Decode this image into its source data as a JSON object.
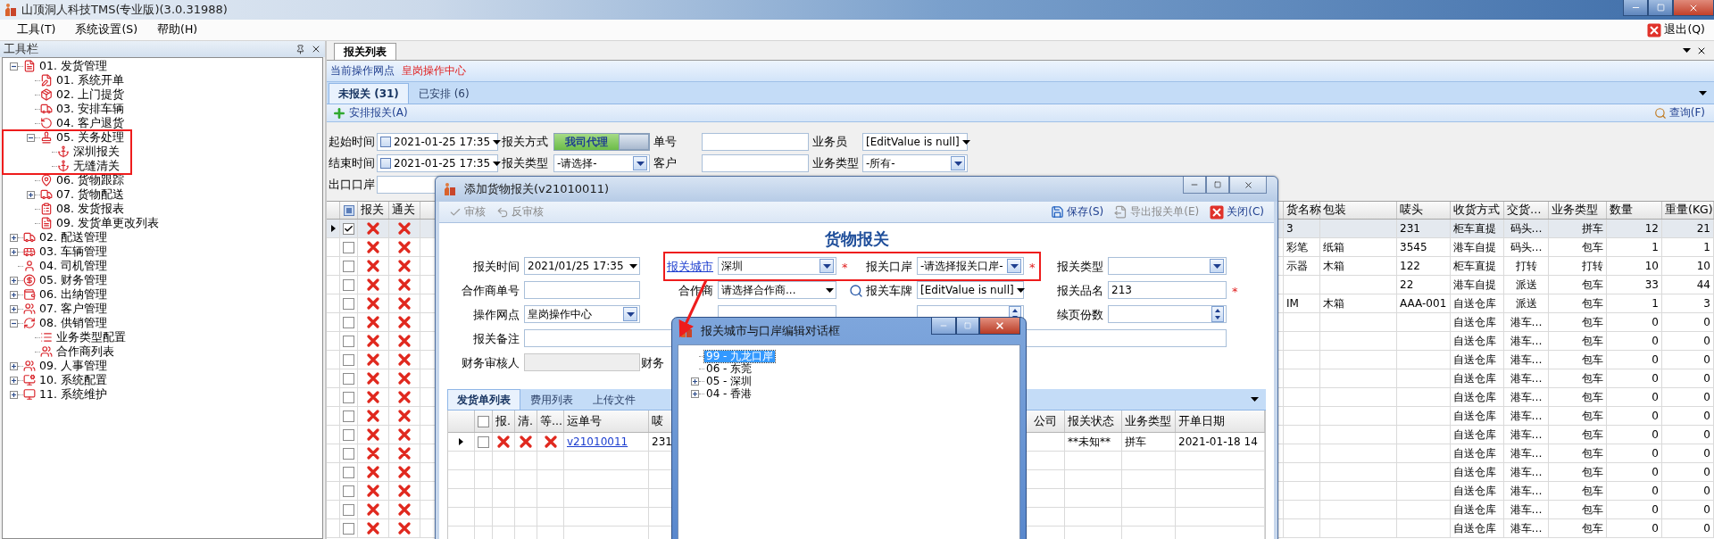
{
  "window": {
    "title": "山顶洞人科技TMS(专业版)(3.0.31988)"
  },
  "menu": [
    "工具(T)",
    "系统设置(S)",
    "帮助(H)"
  ],
  "exit_button": "退出(Q)",
  "sidebar": {
    "title": "工具栏",
    "items": [
      {
        "label": "01. 发货管理",
        "expanded": true,
        "children": [
          {
            "label": "01. 系统开单"
          },
          {
            "label": "02. 上门提货"
          },
          {
            "label": "03. 安排车辆"
          },
          {
            "label": "04. 客户退货"
          },
          {
            "label": "05. 关务处理",
            "expanded": true,
            "children": [
              {
                "label": "深圳报关"
              },
              {
                "label": "无缝清关"
              }
            ]
          },
          {
            "label": "06. 货物跟踪"
          },
          {
            "label": "07. 货物配送",
            "expanded": false
          },
          {
            "label": "08. 发货报表"
          },
          {
            "label": "09. 发货单更改列表"
          }
        ]
      },
      {
        "label": "02. 配送管理",
        "expanded": false
      },
      {
        "label": "03. 车辆管理",
        "expanded": false
      },
      {
        "label": "04. 司机管理"
      },
      {
        "label": "05. 财务管理",
        "expanded": false
      },
      {
        "label": "06. 出纳管理",
        "expanded": false
      },
      {
        "label": "07. 客户管理",
        "expanded": false
      },
      {
        "label": "08. 供销管理",
        "expanded": true,
        "children": [
          {
            "label": "业务类型配置"
          },
          {
            "label": "合作商列表"
          }
        ]
      },
      {
        "label": "09. 人事管理",
        "expanded": false
      },
      {
        "label": "10. 系统配置",
        "expanded": false
      },
      {
        "label": "11. 系统维护",
        "expanded": false
      }
    ]
  },
  "doc_tabs": [
    {
      "label": "报关列表",
      "selected": true
    }
  ],
  "operation_point": {
    "label": "当前操作网点",
    "value": "皇岗操作中心"
  },
  "status_tabs": [
    {
      "label": "未报关 (31)",
      "selected": true
    },
    {
      "label": "已安排 (6)",
      "selected": false
    }
  ],
  "actions": {
    "arrange": "安排报关(A)",
    "query": "查询(F)"
  },
  "filters": [
    [
      {
        "label": "起始时间",
        "kind": "date",
        "value": "2021-01-25 17:35",
        "checked": false
      },
      {
        "label": "报关方式",
        "kind": "switch",
        "value": "我司代理",
        "on": true
      },
      {
        "label": "单号",
        "kind": "text"
      },
      {
        "label": "业务员",
        "kind": "dropdown",
        "value": "[EditValue is null]"
      }
    ],
    [
      {
        "label": "结束时间",
        "kind": "date",
        "value": "2021-01-25 17:35",
        "checked": false
      },
      {
        "label": "报关类型",
        "kind": "select",
        "value": "-请选择-"
      },
      {
        "label": "客户",
        "kind": "text"
      },
      {
        "label": "业务类型",
        "kind": "select",
        "value": "-所有-"
      }
    ],
    [
      {
        "label": "出口口岸",
        "kind": "text"
      }
    ]
  ],
  "table": {
    "status_columns": [
      "报关",
      "通关"
    ],
    "columns": [
      "货名称",
      "包装",
      "唛头",
      "收货方式",
      "交货…",
      "业务类型",
      "数量",
      "重量(KG)"
    ],
    "rows": [
      {
        "selected": true,
        "checked": true,
        "cells": [
          "3",
          "",
          "231",
          "柜车直提",
          "码头…",
          "拼车",
          "12",
          "21"
        ]
      },
      {
        "selected": false,
        "checked": false,
        "cells": [
          "彩笔",
          "纸箱",
          "3545",
          "港车自提",
          "码头…",
          "包车",
          "1",
          "1"
        ]
      },
      {
        "selected": false,
        "checked": false,
        "cells": [
          "示器",
          "木箱",
          "122",
          "柜车直提",
          "打转",
          "打转",
          "10",
          "10"
        ]
      },
      {
        "selected": false,
        "checked": false,
        "cells": [
          "",
          "",
          "22",
          "港车自提",
          "派送",
          "包车",
          "33",
          "44"
        ]
      },
      {
        "selected": false,
        "checked": false,
        "cells": [
          "IM",
          "木箱",
          "AAA-001",
          "自送仓库",
          "派送",
          "包车",
          "1",
          "3"
        ]
      },
      {
        "selected": false,
        "checked": false,
        "cells": [
          "",
          "",
          "",
          "自送仓库",
          "港车…",
          "包车",
          "0",
          "0"
        ]
      },
      {
        "selected": false,
        "checked": false,
        "cells": [
          "",
          "",
          "",
          "自送仓库",
          "港车…",
          "包车",
          "0",
          "0"
        ]
      },
      {
        "selected": false,
        "checked": false,
        "cells": [
          "",
          "",
          "",
          "自送仓库",
          "港车…",
          "包车",
          "0",
          "0"
        ]
      },
      {
        "selected": false,
        "checked": false,
        "cells": [
          "",
          "",
          "",
          "自送仓库",
          "港车…",
          "包车",
          "0",
          "0"
        ]
      },
      {
        "selected": false,
        "checked": false,
        "cells": [
          "",
          "",
          "",
          "自送仓库",
          "港车…",
          "包车",
          "0",
          "0"
        ]
      },
      {
        "selected": false,
        "checked": false,
        "cells": [
          "",
          "",
          "",
          "自送仓库",
          "港车…",
          "包车",
          "0",
          "0"
        ]
      },
      {
        "selected": false,
        "checked": false,
        "cells": [
          "",
          "",
          "",
          "自送仓库",
          "港车…",
          "包车",
          "0",
          "0"
        ]
      },
      {
        "selected": false,
        "checked": false,
        "cells": [
          "",
          "",
          "",
          "自送仓库",
          "港车…",
          "包车",
          "0",
          "0"
        ]
      },
      {
        "selected": false,
        "checked": false,
        "cells": [
          "",
          "",
          "",
          "自送仓库",
          "港车…",
          "包车",
          "0",
          "0"
        ]
      },
      {
        "selected": false,
        "checked": false,
        "cells": [
          "",
          "",
          "",
          "自送仓库",
          "港车…",
          "包车",
          "0",
          "0"
        ]
      },
      {
        "selected": false,
        "checked": false,
        "cells": [
          "",
          "",
          "",
          "自送仓库",
          "港车…",
          "包车",
          "0",
          "0"
        ]
      },
      {
        "selected": false,
        "checked": false,
        "cells": [
          "",
          "",
          "",
          "自送仓库",
          "港车…",
          "包车",
          "0",
          "0"
        ]
      }
    ]
  },
  "cargo_dialog": {
    "title": "添加货物报关(v21010011)",
    "toolbar": [
      {
        "label": "审核",
        "disabled": true
      },
      {
        "label": "反审核",
        "disabled": true
      },
      {
        "label": "保存(S)",
        "disabled": false
      },
      {
        "label": "导出报关单(E)",
        "disabled": true
      },
      {
        "label": "关闭(C)",
        "disabled": false
      }
    ],
    "heading": "货物报关",
    "fields": [
      {
        "label": "报关时间",
        "kind": "date",
        "value": "2021/01/25 17:35"
      },
      {
        "label": "报关城市",
        "kind": "select",
        "value": "深圳",
        "link": true,
        "required_mark": "*"
      },
      {
        "label": "报关口岸",
        "kind": "select",
        "value": "-请选择报关口岸-",
        "required_mark": "*"
      },
      {
        "label": "报关类型",
        "kind": "select"
      },
      {
        "label": "合作商单号",
        "kind": "text"
      },
      {
        "label": "合作商",
        "kind": "dropdown",
        "value": "请选择合作商..."
      },
      {
        "label": "报关车牌",
        "kind": "search_dropdown",
        "value": "[EditValue is null]"
      },
      {
        "label": "报关品名",
        "kind": "text",
        "value": "213",
        "required_mark": "*"
      },
      {
        "label": "操作网点",
        "kind": "select",
        "value": "皇岗操作中心"
      },
      {
        "kind": "text"
      },
      {
        "kind": "spin"
      },
      {
        "label": "续页份数",
        "kind": "spin"
      },
      {
        "label": "报关备注",
        "kind": "wide_text"
      },
      {
        "label": "财务审核人",
        "kind": "readonly"
      },
      {
        "label": "财务",
        "kind": "label"
      }
    ],
    "tabs": [
      {
        "label": "发货单列表",
        "selected": true
      },
      {
        "label": "费用列表",
        "selected": false
      },
      {
        "label": "上传文件",
        "selected": false
      }
    ],
    "grid": {
      "all_checked": false,
      "columns": [
        "报.",
        "清.",
        "等...",
        "运单号",
        "唛",
        "公司",
        "报关状态",
        "业务类型",
        "开单日期"
      ],
      "rows": [
        {
          "selected": true,
          "checked": false,
          "waybill": "v21010011",
          "mark": "231",
          "status": "**未知**",
          "type": "拼车",
          "date": "2021-01-18 14"
        }
      ]
    }
  },
  "port_dialog": {
    "title": "报关城市与口岸编辑对话框",
    "tree": [
      {
        "label": "99 - 九龙口岸",
        "selected": true
      },
      {
        "label": "06 - 东莞",
        "selected": false
      },
      {
        "label": "05 - 深圳",
        "selected": false,
        "expanded": false
      },
      {
        "label": "04 - 香港",
        "selected": false,
        "expanded": false
      }
    ]
  }
}
